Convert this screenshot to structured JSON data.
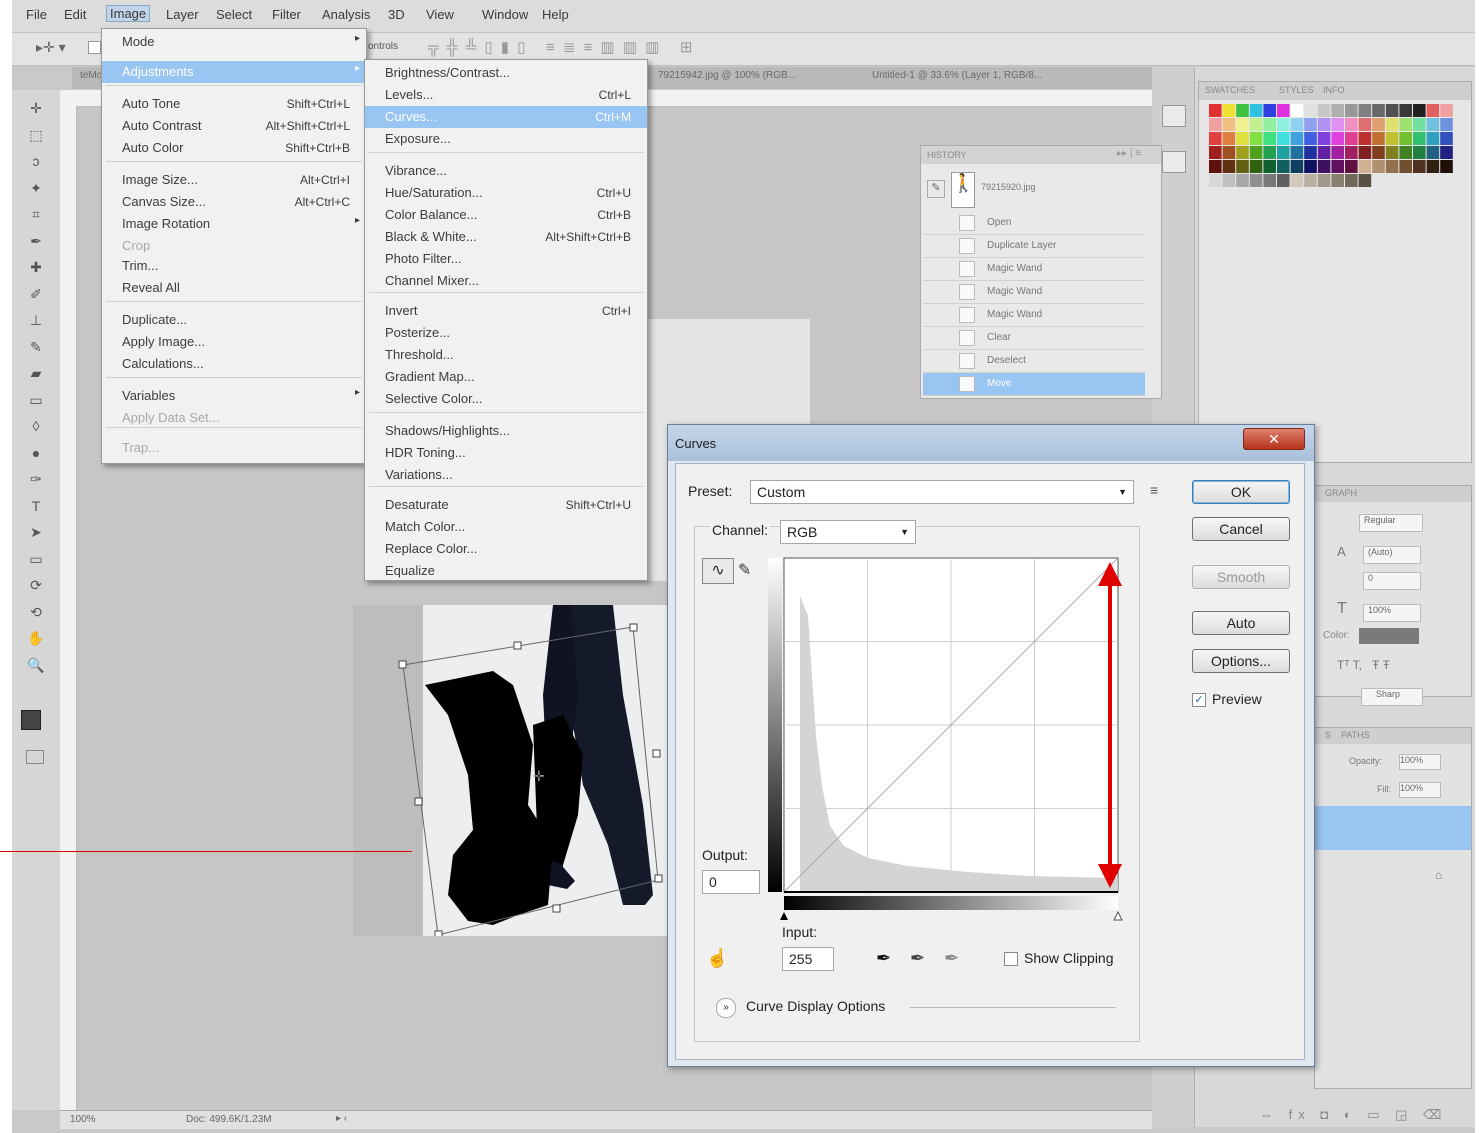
{
  "menubar": [
    "File",
    "Edit",
    "Image",
    "Layer",
    "Select",
    "Filter",
    "Analysis",
    "3D",
    "View",
    "Window",
    "Help"
  ],
  "options_bar": {
    "label": "ontrols"
  },
  "doc_tabs": [
    "teMo",
    "79215942.jpg @ 100% (RGB...",
    "Untitled-1 @ 33.6% (Layer 1, RGB/8..."
  ],
  "image_menu": [
    {
      "label": "Mode",
      "shortcut": "",
      "sub": true,
      "disabled": false,
      "sel": false
    },
    {
      "label": "Adjustments",
      "shortcut": "",
      "sub": true,
      "disabled": false,
      "sel": true
    },
    {
      "label": "Auto Tone",
      "shortcut": "Shift+Ctrl+L",
      "sub": false,
      "disabled": false,
      "sel": false
    },
    {
      "label": "Auto Contrast",
      "shortcut": "Alt+Shift+Ctrl+L",
      "sub": false,
      "disabled": false,
      "sel": false
    },
    {
      "label": "Auto Color",
      "shortcut": "Shift+Ctrl+B",
      "sub": false,
      "disabled": false,
      "sel": false
    },
    {
      "label": "Image Size...",
      "shortcut": "Alt+Ctrl+I",
      "sub": false,
      "disabled": false,
      "sel": false
    },
    {
      "label": "Canvas Size...",
      "shortcut": "Alt+Ctrl+C",
      "sub": false,
      "disabled": false,
      "sel": false
    },
    {
      "label": "Image Rotation",
      "shortcut": "",
      "sub": true,
      "disabled": false,
      "sel": false
    },
    {
      "label": "Crop",
      "shortcut": "",
      "sub": false,
      "disabled": true,
      "sel": false
    },
    {
      "label": "Trim...",
      "shortcut": "",
      "sub": false,
      "disabled": false,
      "sel": false
    },
    {
      "label": "Reveal All",
      "shortcut": "",
      "sub": false,
      "disabled": false,
      "sel": false
    },
    {
      "label": "Duplicate...",
      "shortcut": "",
      "sub": false,
      "disabled": false,
      "sel": false
    },
    {
      "label": "Apply Image...",
      "shortcut": "",
      "sub": false,
      "disabled": false,
      "sel": false
    },
    {
      "label": "Calculations...",
      "shortcut": "",
      "sub": false,
      "disabled": false,
      "sel": false
    },
    {
      "label": "Variables",
      "shortcut": "",
      "sub": true,
      "disabled": false,
      "sel": false
    },
    {
      "label": "Apply Data Set...",
      "shortcut": "",
      "sub": false,
      "disabled": true,
      "sel": false
    },
    {
      "label": "Trap...",
      "shortcut": "",
      "sub": false,
      "disabled": true,
      "sel": false
    }
  ],
  "adjust_menu": [
    {
      "label": "Brightness/Contrast...",
      "shortcut": "",
      "sel": false
    },
    {
      "label": "Levels...",
      "shortcut": "Ctrl+L",
      "sel": false
    },
    {
      "label": "Curves...",
      "shortcut": "Ctrl+M",
      "sel": true
    },
    {
      "label": "Exposure...",
      "shortcut": "",
      "sel": false
    },
    {
      "label": "Vibrance...",
      "shortcut": "",
      "sel": false
    },
    {
      "label": "Hue/Saturation...",
      "shortcut": "Ctrl+U",
      "sel": false
    },
    {
      "label": "Color Balance...",
      "shortcut": "Ctrl+B",
      "sel": false
    },
    {
      "label": "Black & White...",
      "shortcut": "Alt+Shift+Ctrl+B",
      "sel": false
    },
    {
      "label": "Photo Filter...",
      "shortcut": "",
      "sel": false
    },
    {
      "label": "Channel Mixer...",
      "shortcut": "",
      "sel": false
    },
    {
      "label": "Invert",
      "shortcut": "Ctrl+I",
      "sel": false
    },
    {
      "label": "Posterize...",
      "shortcut": "",
      "sel": false
    },
    {
      "label": "Threshold...",
      "shortcut": "",
      "sel": false
    },
    {
      "label": "Gradient Map...",
      "shortcut": "",
      "sel": false
    },
    {
      "label": "Selective Color...",
      "shortcut": "",
      "sel": false
    },
    {
      "label": "Shadows/Highlights...",
      "shortcut": "",
      "sel": false
    },
    {
      "label": "HDR Toning...",
      "shortcut": "",
      "sel": false
    },
    {
      "label": "Variations...",
      "shortcut": "",
      "sel": false
    },
    {
      "label": "Desaturate",
      "shortcut": "Shift+Ctrl+U",
      "sel": false
    },
    {
      "label": "Match Color...",
      "shortcut": "",
      "sel": false
    },
    {
      "label": "Replace Color...",
      "shortcut": "",
      "sel": false
    },
    {
      "label": "Equalize",
      "shortcut": "",
      "sel": false
    }
  ],
  "history": {
    "title": "HISTORY",
    "snapshot": "79215920.jpg",
    "items": [
      "Open",
      "Duplicate Layer",
      "Magic Wand",
      "Magic Wand",
      "Magic Wand",
      "Clear",
      "Deselect",
      "Move"
    ]
  },
  "swatches_tabs": [
    "SWATCHES",
    "STYLES",
    "INFO"
  ],
  "character": {
    "font_style": "Regular",
    "leading": "(Auto)",
    "tracking": "0",
    "scale": "100%",
    "color_label": "Color:",
    "aa": "Sharp",
    "tab": "GRAPH"
  },
  "layers": {
    "tabs": [
      "S",
      "PATHS"
    ],
    "opacity_label": "Opacity:",
    "opacity": "100%",
    "fill_label": "Fill:",
    "fill": "100%"
  },
  "status": {
    "zoom": "100%",
    "doc": "Doc: 499.6K/1.23M"
  },
  "curves": {
    "title": "Curves",
    "preset_label": "Preset:",
    "preset_value": "Custom",
    "channel_label": "Channel:",
    "channel_value": "RGB",
    "output_label": "Output:",
    "output_value": "0",
    "input_label": "Input:",
    "input_value": "255",
    "show_clipping": "Show Clipping",
    "display_options": "Curve Display Options",
    "buttons": {
      "ok": "OK",
      "cancel": "Cancel",
      "smooth": "Smooth",
      "auto": "Auto",
      "options": "Options..."
    },
    "preview_label": "Preview",
    "preview_checked": true
  },
  "colors": {
    "accent": "#98c5f2",
    "annotation": "#e00000"
  }
}
